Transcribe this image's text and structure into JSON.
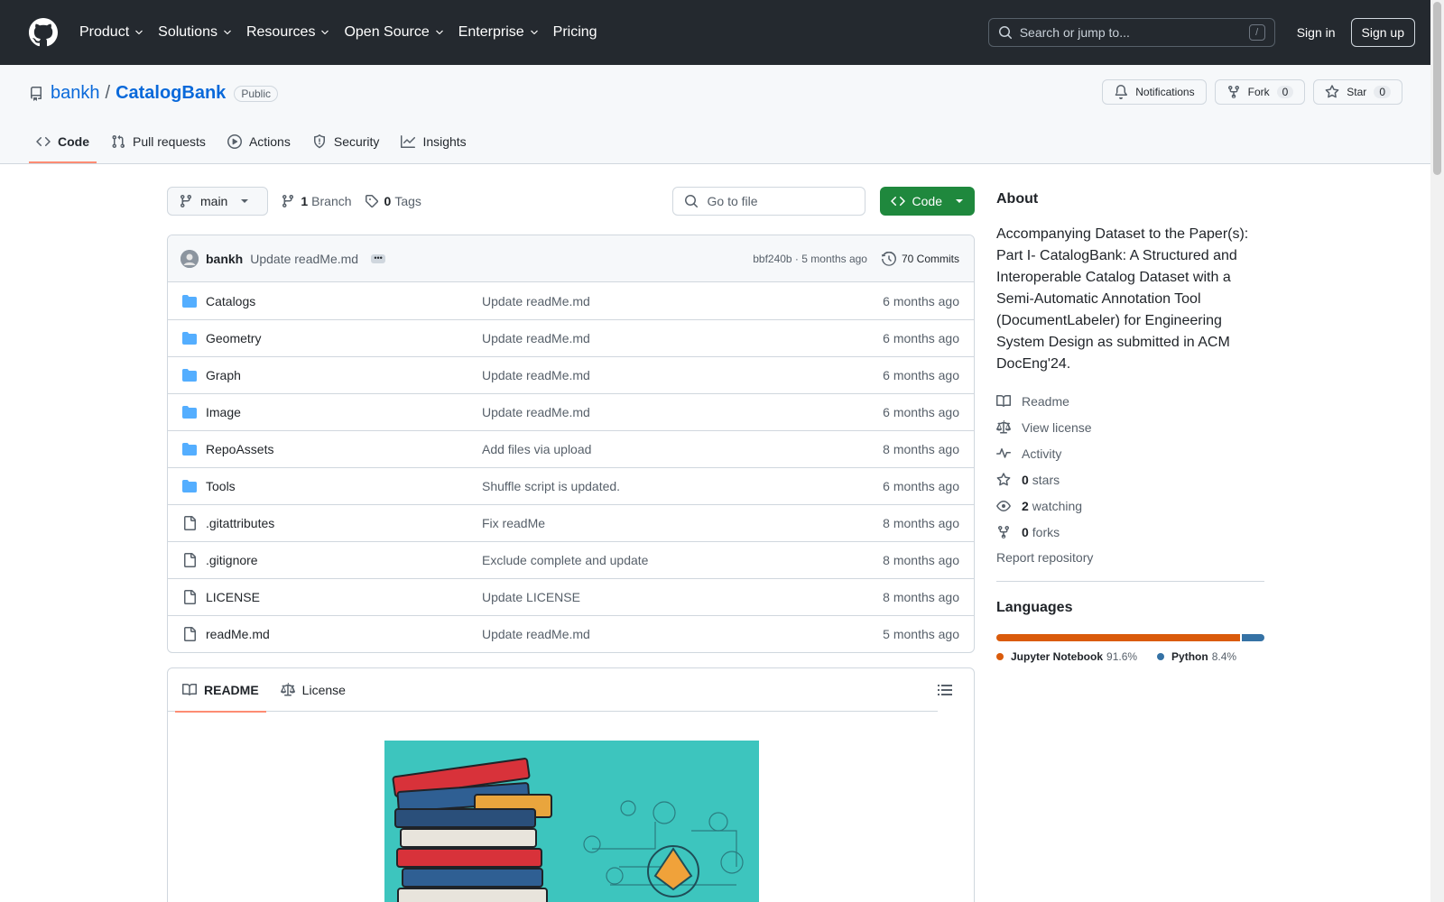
{
  "header": {
    "nav": [
      {
        "label": "Product",
        "has_menu": true
      },
      {
        "label": "Solutions",
        "has_menu": true
      },
      {
        "label": "Resources",
        "has_menu": true
      },
      {
        "label": "Open Source",
        "has_menu": true
      },
      {
        "label": "Enterprise",
        "has_menu": true
      },
      {
        "label": "Pricing",
        "has_menu": false
      }
    ],
    "search_placeholder": "Search or jump to...",
    "search_shortcut": "/",
    "sign_in": "Sign in",
    "sign_up": "Sign up"
  },
  "repo": {
    "owner": "bankh",
    "separator": "/",
    "name": "CatalogBank",
    "visibility": "Public",
    "notifications_label": "Notifications",
    "fork_label": "Fork",
    "fork_count": "0",
    "star_label": "Star",
    "star_count": "0",
    "tabs": [
      {
        "label": "Code",
        "icon": "code-icon",
        "active": true
      },
      {
        "label": "Pull requests",
        "icon": "pull-request-icon",
        "active": false
      },
      {
        "label": "Actions",
        "icon": "play-icon",
        "active": false
      },
      {
        "label": "Security",
        "icon": "shield-icon",
        "active": false
      },
      {
        "label": "Insights",
        "icon": "graph-icon",
        "active": false
      }
    ]
  },
  "toolbar": {
    "branch": "main",
    "branch_count": "1",
    "branch_label": "Branch",
    "tag_count": "0",
    "tag_label": "Tags",
    "goto_placeholder": "Go to file",
    "code_label": "Code"
  },
  "latest_commit": {
    "user": "bankh",
    "message": "Update readMe.md",
    "ellipsis": "•••",
    "meta": "bbf240b · 5 months ago",
    "commits_label": "70 Commits"
  },
  "files": [
    {
      "name": "Catalogs",
      "type": "dir",
      "commit": "Update readMe.md",
      "age": "6 months ago"
    },
    {
      "name": "Geometry",
      "type": "dir",
      "commit": "Update readMe.md",
      "age": "6 months ago"
    },
    {
      "name": "Graph",
      "type": "dir",
      "commit": "Update readMe.md",
      "age": "6 months ago"
    },
    {
      "name": "Image",
      "type": "dir",
      "commit": "Update readMe.md",
      "age": "6 months ago"
    },
    {
      "name": "RepoAssets",
      "type": "dir",
      "commit": "Add files via upload",
      "age": "8 months ago"
    },
    {
      "name": "Tools",
      "type": "dir",
      "commit": "Shuffle script is updated.",
      "age": "6 months ago"
    },
    {
      "name": ".gitattributes",
      "type": "file",
      "commit": "Fix readMe",
      "age": "8 months ago"
    },
    {
      "name": ".gitignore",
      "type": "file",
      "commit": "Exclude complete and update",
      "age": "8 months ago"
    },
    {
      "name": "LICENSE",
      "type": "file",
      "commit": "Update LICENSE",
      "age": "8 months ago"
    },
    {
      "name": "readMe.md",
      "type": "file",
      "commit": "Update readMe.md",
      "age": "5 months ago"
    }
  ],
  "readme": {
    "tabs": [
      {
        "label": "README",
        "icon": "book-icon",
        "active": true
      },
      {
        "label": "License",
        "icon": "law-icon",
        "active": false
      }
    ]
  },
  "sidebar": {
    "about_title": "About",
    "description": "Accompanying Dataset to the Paper(s): Part I- CatalogBank: A Structured and Interoperable Catalog Dataset with a Semi-Automatic Annotation Tool (DocumentLabeler) for Engineering System Design as submitted in ACM DocEng'24.",
    "links": [
      {
        "icon": "book-icon",
        "strong": "",
        "label": "Readme"
      },
      {
        "icon": "law-icon",
        "strong": "",
        "label": "View license"
      },
      {
        "icon": "pulse-icon",
        "strong": "",
        "label": "Activity"
      },
      {
        "icon": "star-icon",
        "strong": "0",
        "label": "stars"
      },
      {
        "icon": "eye-icon",
        "strong": "2",
        "label": "watching"
      },
      {
        "icon": "fork-icon",
        "strong": "0",
        "label": "forks"
      }
    ],
    "report": "Report repository",
    "languages_title": "Languages",
    "languages": [
      {
        "name": "Jupyter Notebook",
        "percent": "91.6%",
        "value": 91.6,
        "color": "#DA5B0B"
      },
      {
        "name": "Python",
        "percent": "8.4%",
        "value": 8.4,
        "color": "#3572A5"
      }
    ]
  },
  "colors": {
    "header_bg": "#24292f",
    "link": "#0969da",
    "code_button": "#1f883d",
    "tab_underline": "#fd8c73"
  }
}
